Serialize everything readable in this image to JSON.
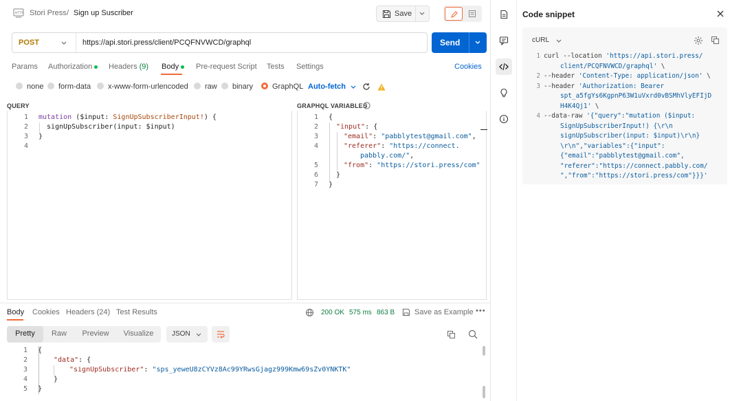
{
  "header": {
    "breadcrumb_parent": "Stori Press",
    "breadcrumb_sep": "/",
    "title": "Sign up Suscriber",
    "save_label": "Save"
  },
  "request": {
    "method": "POST",
    "url": "https://api.stori.press/client/PCQFNVWCD/graphql",
    "send_label": "Send",
    "tabs": [
      {
        "label": "Params"
      },
      {
        "label": "Authorization"
      },
      {
        "label": "Headers",
        "count": "(9)"
      },
      {
        "label": "Body"
      },
      {
        "label": "Pre-request Script"
      },
      {
        "label": "Tests"
      },
      {
        "label": "Settings"
      }
    ],
    "cookies_label": "Cookies",
    "body_types": [
      "none",
      "form-data",
      "x-www-form-urlencoded",
      "raw",
      "binary",
      "GraphQL"
    ],
    "selected_body_type": "GraphQL",
    "autofetch_label": "Auto-fetch"
  },
  "query": {
    "label": "QUERY",
    "lines": [
      {
        "n": "1",
        "kw": "mutation",
        "rest1": " ($input: ",
        "type": "SignUpSubscriberInput!",
        "rest2": ") {"
      },
      {
        "n": "2",
        "text": "  signUpSubscriber(input: $input)"
      },
      {
        "n": "3",
        "text": "}"
      },
      {
        "n": "4",
        "text": ""
      }
    ]
  },
  "variables": {
    "label": "GRAPHQL VARIABLES",
    "lines": [
      {
        "n": "1",
        "text": "{"
      },
      {
        "n": "2",
        "key": "\"input\"",
        "after": ": {"
      },
      {
        "n": "3",
        "key": "\"email\"",
        "after": ": ",
        "str": "\"pabblytest@gmail.com\"",
        "tail": ","
      },
      {
        "n": "4",
        "key": "\"referer\"",
        "after": ": ",
        "str": "\"https://connect.",
        "tail": ""
      },
      {
        "n": "",
        "str": "pabbly.com/\"",
        "tail": ","
      },
      {
        "n": "5",
        "key": "\"from\"",
        "after": ": ",
        "str": "\"https://stori.press/com\"",
        "tail": ""
      },
      {
        "n": "6",
        "text": "}"
      },
      {
        "n": "7",
        "text": "}"
      }
    ]
  },
  "response": {
    "tabs": [
      {
        "label": "Body"
      },
      {
        "label": "Cookies"
      },
      {
        "label": "Headers",
        "count": "(24)"
      },
      {
        "label": "Test Results"
      }
    ],
    "status": "200 OK",
    "time": "575 ms",
    "size": "863 B",
    "save_example_label": "Save as Example",
    "more_label": "•••",
    "views": [
      "Pretty",
      "Raw",
      "Preview",
      "Visualize"
    ],
    "active_view": "Pretty",
    "format": "JSON",
    "lines": [
      {
        "n": "1",
        "text": "{"
      },
      {
        "n": "2",
        "key": "\"data\"",
        "after": ": {"
      },
      {
        "n": "3",
        "key": "\"signUpSubscriber\"",
        "after": ": ",
        "str": "\"sps_yeweU8zCYVz8Ac99YRwsGjagz999Kmw69sZv0YNKTK\""
      },
      {
        "n": "4",
        "text": "}"
      },
      {
        "n": "5",
        "text": "}"
      }
    ]
  },
  "snippet": {
    "title": "Code snippet",
    "language": "cURL",
    "lines": [
      {
        "n": "1",
        "plain": "curl --location ",
        "str": "'https://api.stori.press/"
      },
      {
        "n": "",
        "str": "client/PCQFNVWCD/graphql'",
        "plain_after": " \\"
      },
      {
        "n": "2",
        "plain": "--header ",
        "str": "'Content-Type: application/json'",
        "plain_after": " \\"
      },
      {
        "n": "3",
        "plain": "--header ",
        "str": "'Authorization: Bearer"
      },
      {
        "n": "",
        "str": "spt_a5fgYs6KgpnP63W1uVxrd0vBSMhVlyEFIjD"
      },
      {
        "n": "",
        "str": "H4K4Qj1'",
        "plain_after": " \\"
      },
      {
        "n": "4",
        "plain": "--data-raw ",
        "str": "'{\"query\":\"mutation ($input:"
      },
      {
        "n": "",
        "str": "SignUpSubscriberInput!) {\\r\\n"
      },
      {
        "n": "",
        "str": "signUpSubscriber(input: $input)\\r\\n}"
      },
      {
        "n": "",
        "str": "\\r\\n\",\"variables\":{\"input\":"
      },
      {
        "n": "",
        "str": "{\"email\":\"pabblytest@gmail.com\","
      },
      {
        "n": "",
        "str": "\"referer\":\"https://connect.pabbly.com/"
      },
      {
        "n": "",
        "str": "\",\"from\":\"https://stori.press/com\"}}}'"
      }
    ]
  },
  "colors": {
    "accent": "#f26b3a",
    "primary": "#0265d2",
    "method_post": "#ad7a03",
    "status_ok": "#0c7f3f"
  },
  "icons": {
    "header": [
      "http-icon",
      "save-icon",
      "chevron-down-icon",
      "pencil-icon",
      "document-icon"
    ],
    "rail": [
      "document-icon",
      "comment-icon",
      "code-icon",
      "lightbulb-icon",
      "info-icon"
    ],
    "response": [
      "globe-icon",
      "save-icon",
      "copy-icon",
      "search-icon",
      "wrap-icon"
    ],
    "snippet": [
      "gear-icon",
      "copy-icon",
      "close-icon"
    ]
  }
}
